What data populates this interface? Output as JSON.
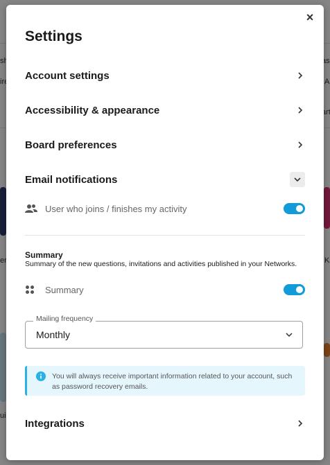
{
  "background": {
    "left_fragments": [
      "sh",
      "ire",
      "ers",
      "ui"
    ],
    "right_fragments": [
      "as",
      "A",
      "art",
      "K"
    ]
  },
  "modal": {
    "title": "Settings",
    "close_label": "×",
    "sections": {
      "account": "Account settings",
      "accessibility": "Accessibility & appearance",
      "board": "Board preferences",
      "email": "Email notifications",
      "integrations": "Integrations"
    },
    "email_notifications": {
      "user_joins_label": "User who joins / finishes my activity",
      "user_joins_enabled": true,
      "summary_title": "Summary",
      "summary_description": "Summary of the new questions, invitations and activities published in your Networks.",
      "summary_label": "Summary",
      "summary_enabled": true,
      "mailing_frequency_label": "Mailing frequency",
      "mailing_frequency_value": "Monthly",
      "info_text": "You will always receive important information related to your account, such as password recovery emails."
    }
  },
  "colors": {
    "toggle_on": "#119bd8",
    "info_bg": "#e5f6fd",
    "info_accent": "#29b1e8"
  }
}
